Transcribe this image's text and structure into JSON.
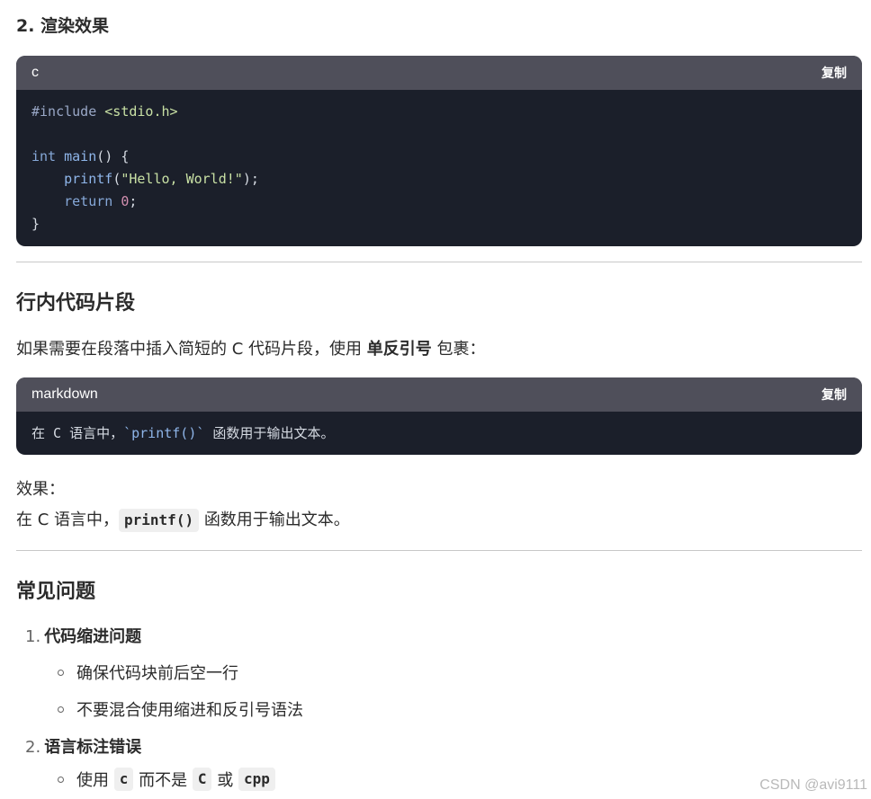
{
  "section_render": {
    "title": "2. 渲染效果"
  },
  "code_block_1": {
    "language": "c",
    "copy_label": "复制",
    "line1_pre": "#include",
    "line1_hdr": "<stdio.h>",
    "line3_kw": "int",
    "line3_fn": "main",
    "line3_rest": "() {",
    "line4_fn": "printf",
    "line4_open": "(",
    "line4_str": "\"Hello, World!\"",
    "line4_close": ");",
    "line5_kw": "return",
    "line5_num": "0",
    "line5_end": ";",
    "line6": "}"
  },
  "inline_section": {
    "title": "行内代码片段",
    "para_before": "如果需要在段落中插入简短的 C 代码片段，使用",
    "para_bold": "单反引号",
    "para_after": "包裹："
  },
  "code_block_2": {
    "language": "markdown",
    "copy_label": "复制",
    "text_before": "在 C 语言中，",
    "code_span": "`printf()`",
    "text_after": " 函数用于输出文本。"
  },
  "effect": {
    "label": "效果：",
    "text_before": "在 C 语言中，",
    "code": "printf()",
    "text_after": "函数用于输出文本。"
  },
  "faq": {
    "title": "常见问题",
    "item1_num": "1.",
    "item1_title": "代码缩进问题",
    "item1_sub1": "确保代码块前后空一行",
    "item1_sub2": "不要混合使用缩进和反引号语法",
    "item2_num": "2.",
    "item2_title": "语言标注错误",
    "item2_sub1_pre": "使用",
    "item2_sub1_c": "c",
    "item2_sub1_mid": "而不是",
    "item2_sub1_C": "C",
    "item2_sub1_or": "或",
    "item2_sub1_cpp": "cpp"
  },
  "watermark": "CSDN @avi9111"
}
